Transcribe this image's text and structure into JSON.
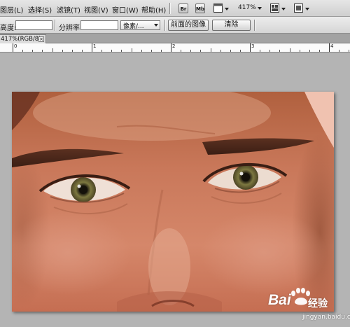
{
  "menu": {
    "items": [
      "图层(L)",
      "选择(S)",
      "滤镜(T)",
      "视图(V)",
      "窗口(W)",
      "帮助(H)"
    ]
  },
  "toolbar": {
    "br_label": "Br",
    "mb_label": "Mb",
    "zoom_level": "417%",
    "icons": [
      "bridge-icon",
      "minibridge-icon",
      "view-extras-icon",
      "arrange-documents-icon",
      "screen-mode-icon"
    ]
  },
  "options": {
    "height_label": "高度:",
    "height_value": "",
    "resolution_label": "分辨率:",
    "resolution_value": "",
    "unit_select": "像素/...",
    "front_image_button": "前面的图像",
    "clear_button": "清除"
  },
  "document": {
    "tab_label": "417%(RGB/8)",
    "close_glyph": "×"
  },
  "ruler": {
    "labels": [
      "0",
      "1",
      "2",
      "3",
      "4"
    ]
  },
  "watermark": {
    "brand": "Bai",
    "brand_suffix": "经验",
    "url": "jingyan.baidu.com"
  },
  "colors": {
    "canvas_bg": "#b4b4b4",
    "skin": "#c9785a",
    "iris": "#6e6a3a"
  }
}
